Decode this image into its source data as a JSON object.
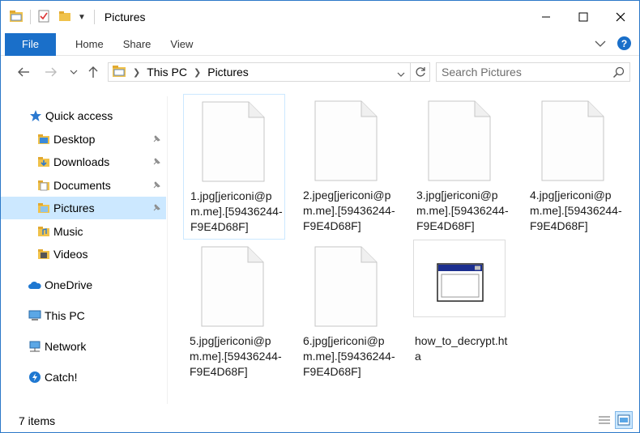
{
  "window": {
    "title": "Pictures"
  },
  "ribbon": {
    "file": "File",
    "home": "Home",
    "share": "Share",
    "view": "View",
    "help": "?"
  },
  "address": {
    "crumbs": [
      "This PC",
      "Pictures"
    ],
    "search_placeholder": "Search Pictures"
  },
  "sidebar": {
    "items": [
      {
        "label": "Quick access",
        "icon": "star-icon"
      },
      {
        "label": "Desktop",
        "icon": "folder-icon",
        "pinned": true
      },
      {
        "label": "Downloads",
        "icon": "download-folder-icon",
        "pinned": true
      },
      {
        "label": "Documents",
        "icon": "documents-folder-icon",
        "pinned": true
      },
      {
        "label": "Pictures",
        "icon": "pictures-folder-icon",
        "pinned": true,
        "selected": true
      },
      {
        "label": "Music",
        "icon": "music-folder-icon"
      },
      {
        "label": "Videos",
        "icon": "videos-folder-icon"
      },
      {
        "label": "OneDrive",
        "icon": "cloud-icon"
      },
      {
        "label": "This PC",
        "icon": "computer-icon"
      },
      {
        "label": "Network",
        "icon": "network-icon"
      },
      {
        "label": "Catch!",
        "icon": "catch-icon"
      }
    ]
  },
  "files": [
    {
      "name": "1.jpg[jericoni@pm.me].[59436244-F9E4D68F]",
      "type": "document"
    },
    {
      "name": "2.jpeg[jericoni@pm.me].[59436244-F9E4D68F]",
      "type": "document"
    },
    {
      "name": "3.jpg[jericoni@pm.me].[59436244-F9E4D68F]",
      "type": "document"
    },
    {
      "name": "4.jpg[jericoni@pm.me].[59436244-F9E4D68F]",
      "type": "document"
    },
    {
      "name": "5.jpg[jericoni@pm.me].[59436244-F9E4D68F]",
      "type": "document"
    },
    {
      "name": "6.jpg[jericoni@pm.me].[59436244-F9E4D68F]",
      "type": "document"
    },
    {
      "name": "how_to_decrypt.hta",
      "type": "application"
    }
  ],
  "status": {
    "count": "7 items"
  },
  "colors": {
    "accent": "#1a6fc9",
    "selection": "#cce8ff"
  }
}
